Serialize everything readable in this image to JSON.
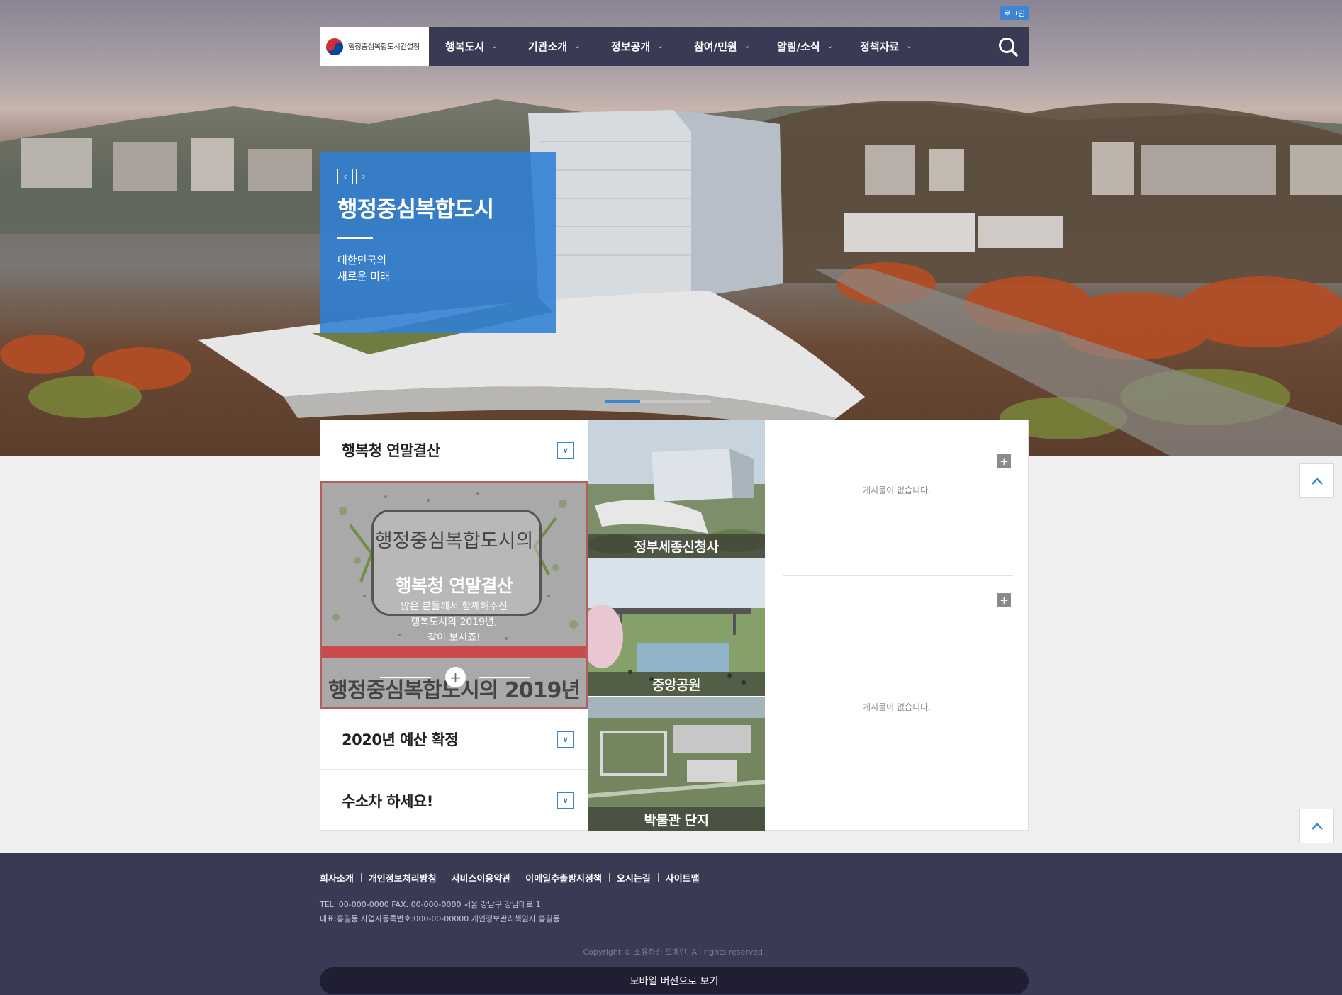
{
  "header": {
    "login_label": "로그인",
    "logo_text": "행정중심복합도시건설청",
    "menu": [
      {
        "label": "행복도시"
      },
      {
        "label": "기관소개"
      },
      {
        "label": "정보공개"
      },
      {
        "label": "참여/민원"
      },
      {
        "label": "알림/소식"
      },
      {
        "label": "정책자료"
      }
    ],
    "chevron": "⌄",
    "search_icon": "search-icon"
  },
  "visual": {
    "prev_label": "‹",
    "next_label": "›",
    "title": "행정중심복합도시",
    "subtitle_line1": "대한민국의",
    "subtitle_line2": "새로운 미래"
  },
  "accordion": {
    "items": [
      {
        "title": "행복청 연말결산",
        "expanded": true
      },
      {
        "title": "2020년 예산 확정",
        "expanded": false
      },
      {
        "title": "수소차 하세요!",
        "expanded": false
      }
    ],
    "toggle_glyph": "∨",
    "featured": {
      "handwriting": "행정중심복합도시의",
      "overlay_title": "행복청 연말결산",
      "overlay_line1": "많은 분들께서 함께해주신",
      "overlay_line2": "행복도시의 2019년,",
      "overlay_line3": "같이 보시죠!",
      "bottom_text": "행정중심복합도시의 2019년",
      "plus_glyph": "+"
    }
  },
  "tiles": [
    {
      "label": "정부세종신청사"
    },
    {
      "label": "중앙공원"
    },
    {
      "label": "박물관 단지"
    }
  ],
  "boards": {
    "plus_glyph": "+",
    "empty_1": "게시물이 없습니다.",
    "empty_2": "게시물이 없습니다."
  },
  "footer": {
    "links": [
      "회사소개",
      "개인정보처리방침",
      "서비스이용약관",
      "이메일추출방지정책",
      "오시는길",
      "사이트맵"
    ],
    "info_line1": "TEL. 00-000-0000 FAX. 00-000-0000 서울 강남구 강남대로 1",
    "info_line2": "대표:홍길동 사업자등록번호:000-00-00000 개인정보관리책임자:홍길동",
    "copyright": "Copyright © 소유하신 도메인. All rights reserved.",
    "mobile_button": "모바일 버전으로 보기"
  },
  "colors": {
    "nav_bg": "#3b3a54",
    "accent": "#3b85d1",
    "footer_bg": "#3b3a54"
  }
}
